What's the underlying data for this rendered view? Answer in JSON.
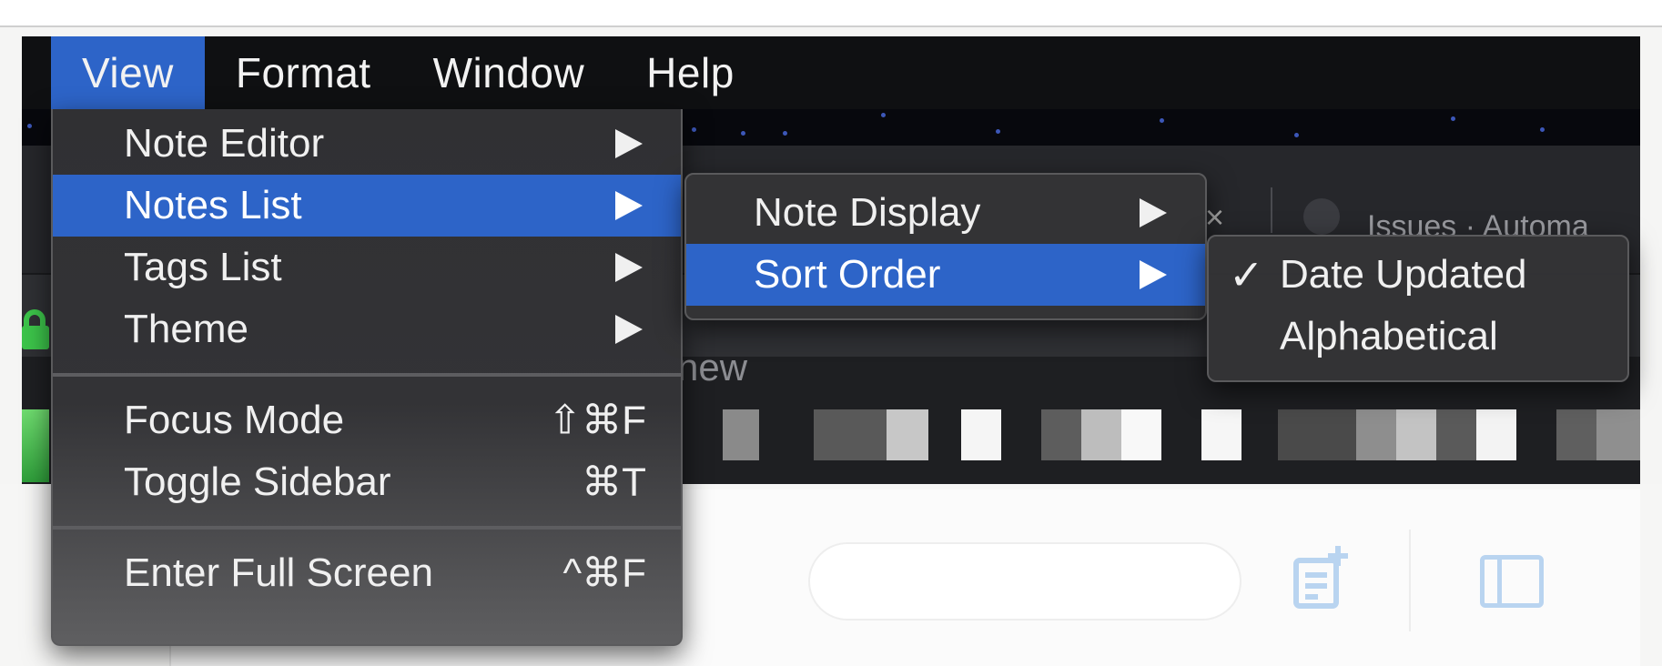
{
  "menubar": {
    "items": [
      {
        "label": "View"
      },
      {
        "label": "Format"
      },
      {
        "label": "Window"
      },
      {
        "label": "Help"
      }
    ]
  },
  "background": {
    "tab_close": "×",
    "tab_title": "Issues · Automa",
    "toolbar_text": "new",
    "colors": {
      "accent": "#2d64c8",
      "lock": "#3cc44a",
      "menubar": "#0f1012"
    }
  },
  "view_menu": {
    "items": [
      {
        "label": "Note Editor",
        "submenu": true
      },
      {
        "label": "Notes List",
        "submenu": true,
        "highlighted": true
      },
      {
        "label": "Tags List",
        "submenu": true
      },
      {
        "label": "Theme",
        "submenu": true
      },
      {
        "label": "Focus Mode",
        "shortcut": "⇧⌘F"
      },
      {
        "label": "Toggle Sidebar",
        "shortcut": "⌘T"
      },
      {
        "label": "Enter Full Screen",
        "shortcut": "^⌘F"
      }
    ]
  },
  "notes_list_submenu": {
    "items": [
      {
        "label": "Note Display",
        "submenu": true
      },
      {
        "label": "Sort Order",
        "submenu": true,
        "highlighted": true
      }
    ]
  },
  "sort_order_submenu": {
    "items": [
      {
        "label": "Date Updated",
        "checked": true,
        "check_mark": "✓"
      },
      {
        "label": "Alphabetical",
        "checked": false
      }
    ]
  }
}
